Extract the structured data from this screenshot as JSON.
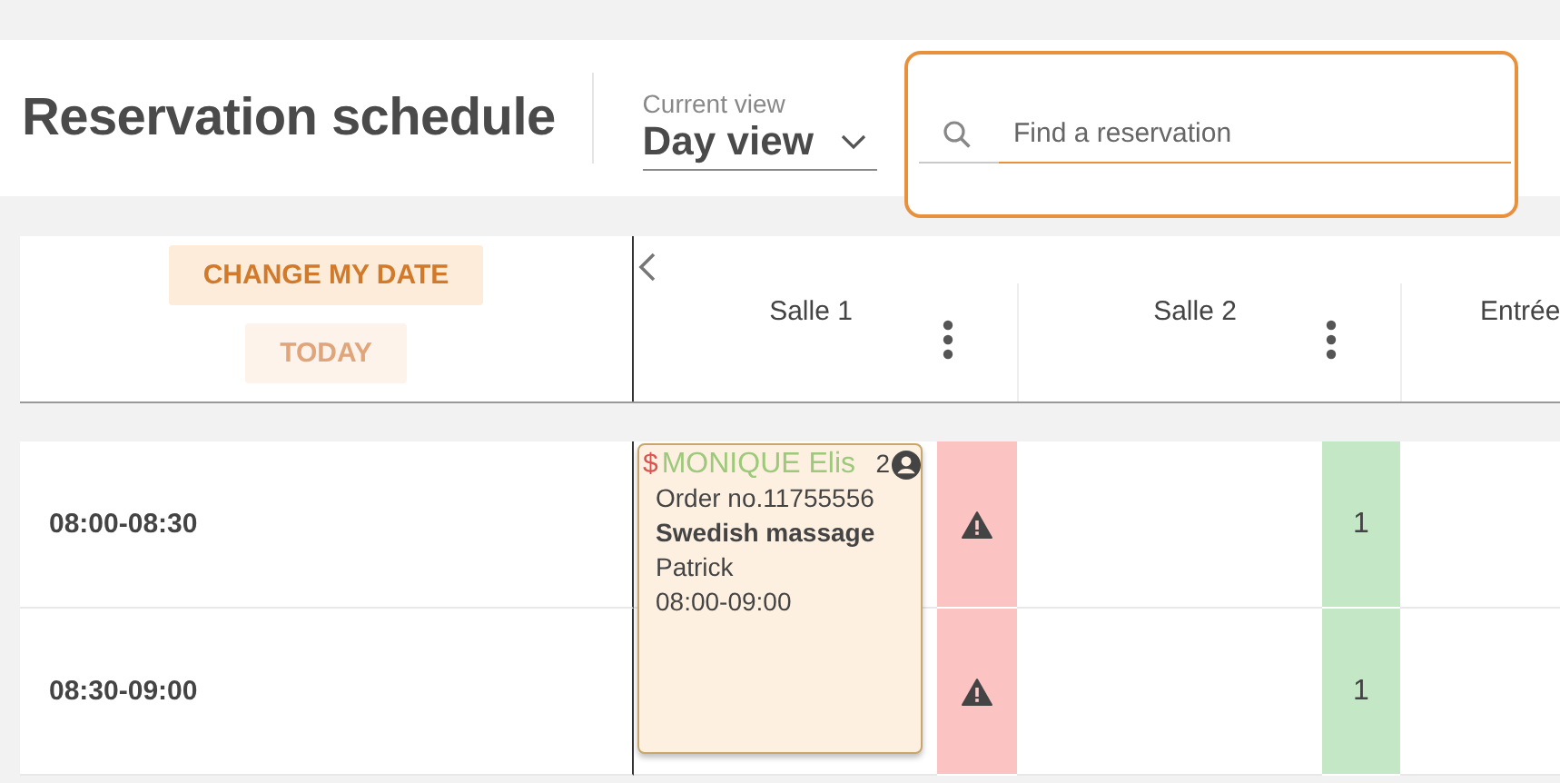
{
  "header": {
    "title": "Reservation schedule",
    "view_label": "Current view",
    "view_value": "Day view",
    "search": {
      "placeholder": "Find a reservation"
    }
  },
  "date_buttons": [
    {
      "label": "CHANGE MY DATE",
      "disabled": false
    },
    {
      "label": "TODAY",
      "disabled": true
    }
  ],
  "columns": [
    {
      "name": "Salle 1",
      "slots": [
        {
          "kind": "warning"
        },
        {
          "kind": "warning"
        }
      ]
    },
    {
      "name": "Salle 2",
      "slots": [
        {
          "kind": "count",
          "text": "1"
        },
        {
          "kind": "count",
          "text": "1"
        }
      ]
    },
    {
      "name": "Entrée"
    }
  ],
  "time_slots": [
    "08:00-08:30",
    "08:30-09:00"
  ],
  "booking": {
    "price_mark": "$",
    "client": "MONIQUE Elis",
    "guests": "2",
    "order": "Order no.11755556",
    "service": "Swedish massage",
    "staff": "Patrick",
    "time": "08:00-09:00"
  }
}
